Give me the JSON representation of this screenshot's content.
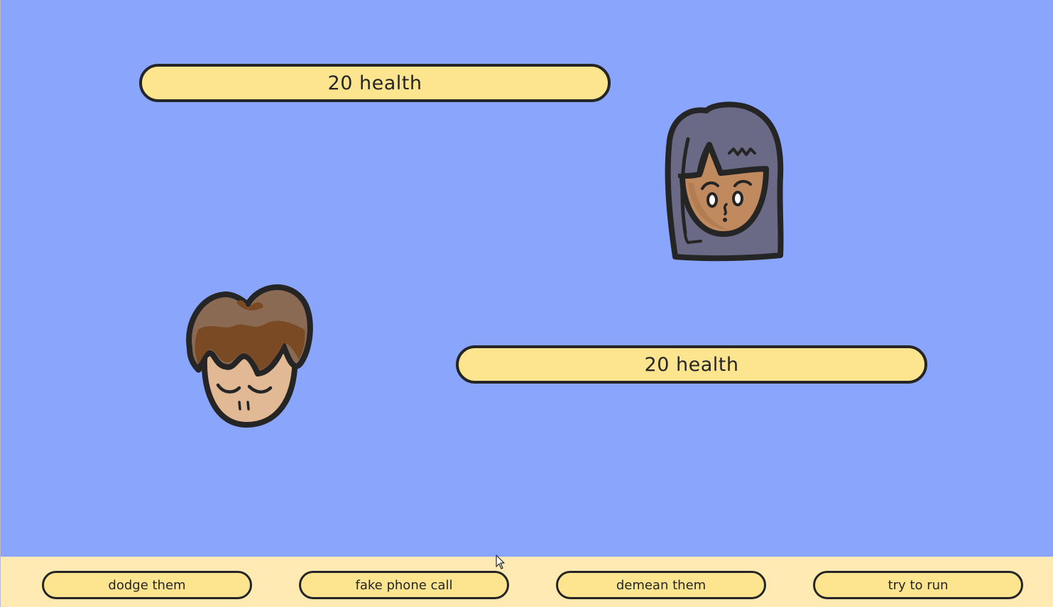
{
  "enemy": {
    "health_label": "20 health",
    "portrait_icon": "girl-with-hair-portrait-icon"
  },
  "player": {
    "health_label": "20 health",
    "portrait_icon": "boy-sleepy-portrait-icon"
  },
  "actions": [
    {
      "label": "dodge them"
    },
    {
      "label": "fake phone call"
    },
    {
      "label": "demean them"
    },
    {
      "label": "try to run"
    }
  ],
  "colors": {
    "background": "#89a5fc",
    "panel": "#feeab2",
    "button_fill": "#fde58f",
    "outline": "#252525"
  }
}
